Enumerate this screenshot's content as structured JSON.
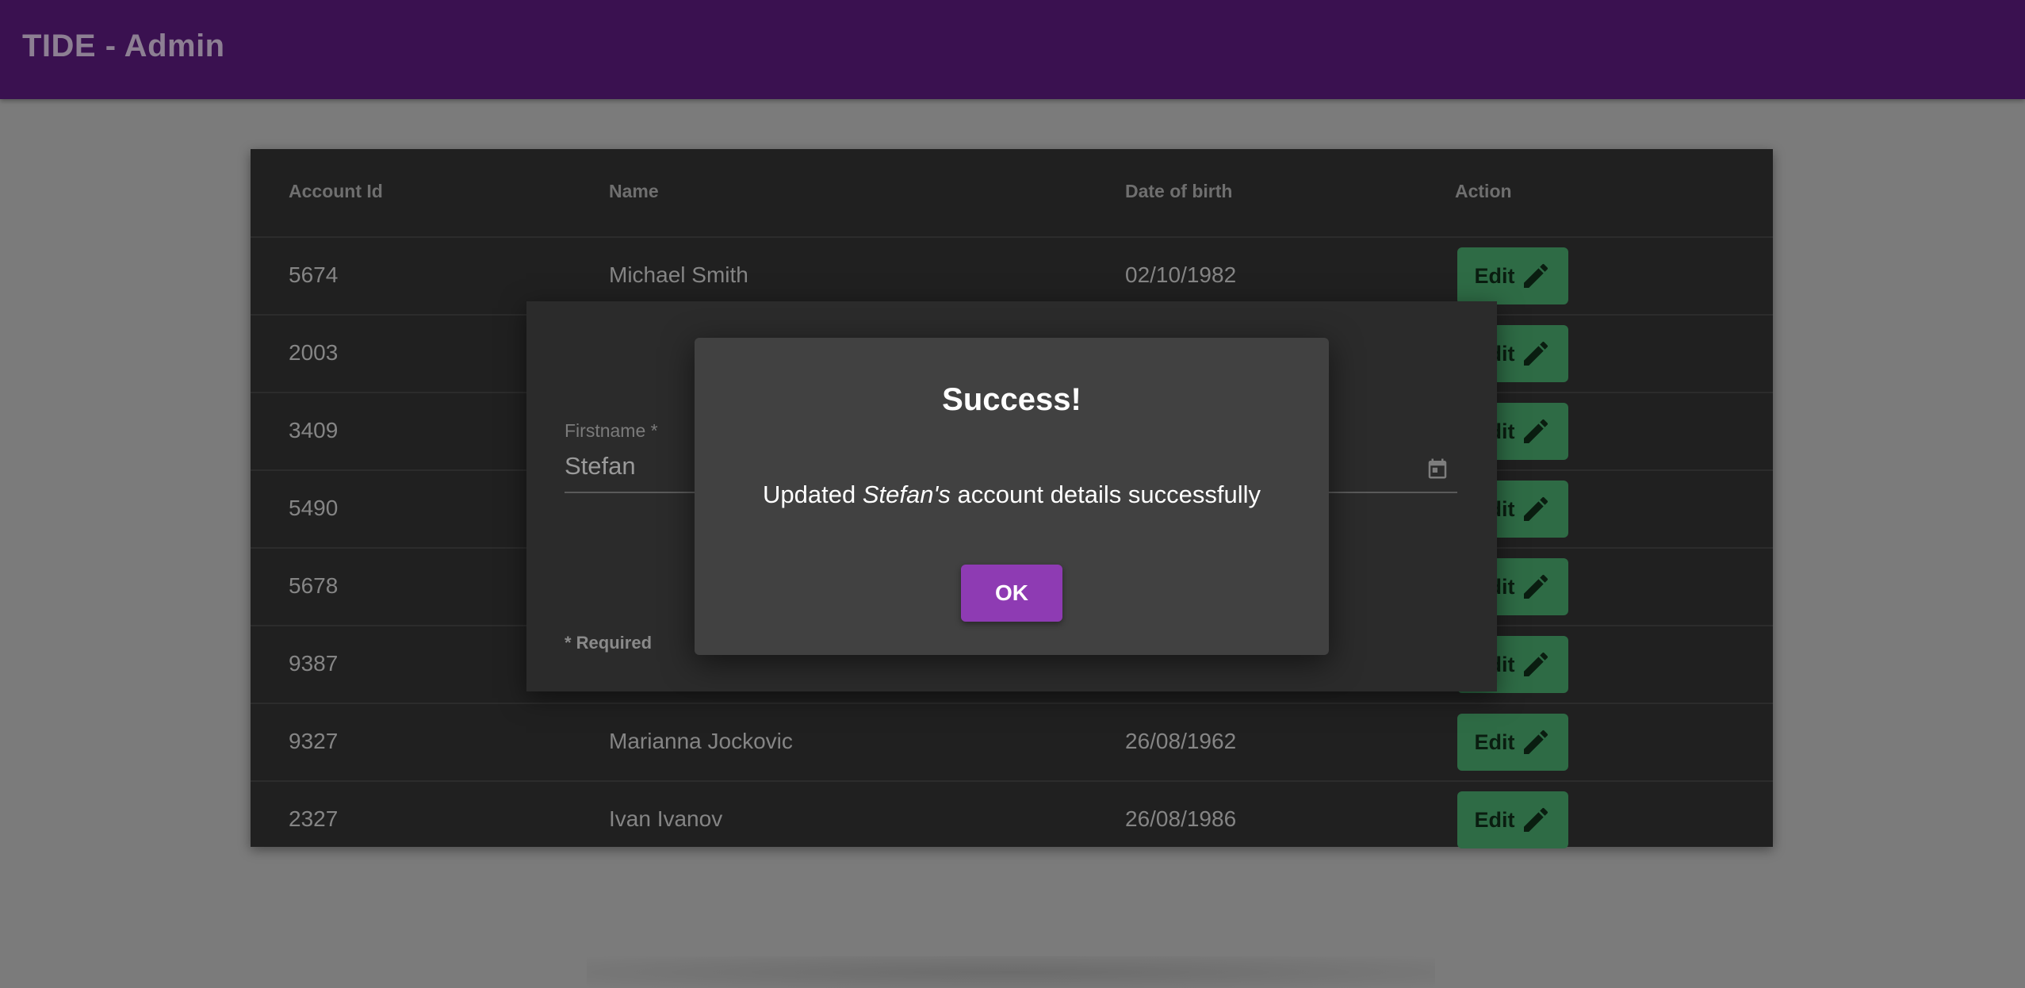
{
  "app": {
    "title": "TIDE - Admin"
  },
  "table": {
    "headers": [
      "Account Id",
      "Name",
      "Date of birth",
      "Action"
    ],
    "rows": [
      {
        "id": "5674",
        "name": "Michael Smith",
        "dob": "02/10/1982",
        "action": "Edit"
      },
      {
        "id": "2003",
        "name": "",
        "dob": "",
        "action": "Edit"
      },
      {
        "id": "3409",
        "name": "",
        "dob": "",
        "action": "Edit"
      },
      {
        "id": "5490",
        "name": "",
        "dob": "",
        "action": "Edit"
      },
      {
        "id": "5678",
        "name": "",
        "dob": "",
        "action": "Edit"
      },
      {
        "id": "9387",
        "name": "",
        "dob": "",
        "action": "Edit"
      },
      {
        "id": "9327",
        "name": "Marianna Jockovic",
        "dob": "26/08/1962",
        "action": "Edit"
      },
      {
        "id": "2327",
        "name": "Ivan Ivanov",
        "dob": "26/08/1986",
        "action": "Edit"
      }
    ]
  },
  "edit_dialog": {
    "firstname_label": "Firstname *",
    "firstname_value": "Stefan",
    "required_note": "* Required",
    "calendar_icon": "calendar-icon"
  },
  "success_dialog": {
    "title": "Success!",
    "message_prefix": "Updated ",
    "message_name": "Stefan's",
    "message_suffix": " account details successfully",
    "ok_label": "OK"
  },
  "colors": {
    "appbar": "#3a1150",
    "edit_button": "#2e6b45",
    "ok_button": "#8e3bb3"
  },
  "icons": {
    "edit": "pencil-icon",
    "date": "calendar-icon"
  }
}
